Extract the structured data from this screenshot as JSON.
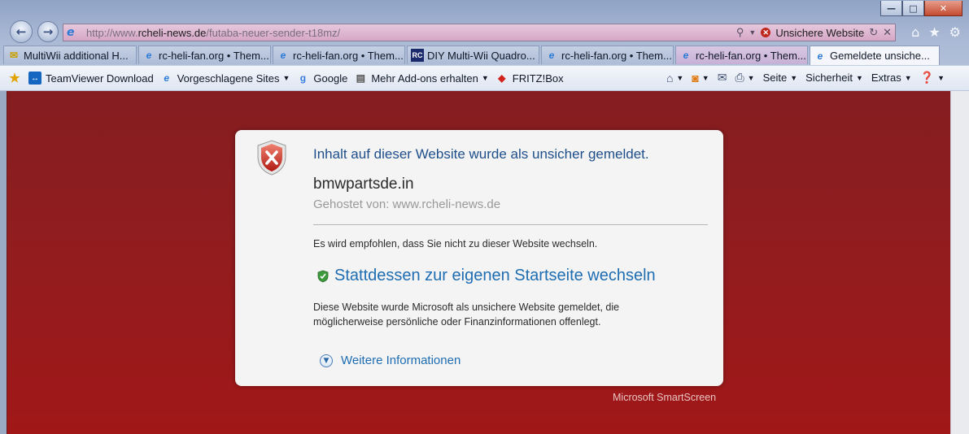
{
  "window": {
    "minimize": "—",
    "maximize": "□",
    "close": "✕"
  },
  "address": {
    "url_prefix": "http://www.",
    "url_domain": "rcheli-news.de",
    "url_path": "/futaba-neuer-sender-t18mz/",
    "security_status": "Unsichere Website"
  },
  "tabs": [
    {
      "label": "MultiWii additional H...",
      "icon": "forum-icon"
    },
    {
      "label": "rc-heli-fan.org • Them...",
      "icon": "ie-icon"
    },
    {
      "label": "rc-heli-fan.org • Them...",
      "icon": "ie-icon"
    },
    {
      "label": "DIY Multi-Wii Quadro...",
      "icon": "rc-icon"
    },
    {
      "label": "rc-heli-fan.org • Them...",
      "icon": "ie-icon"
    },
    {
      "label": "rc-heli-fan.org • Them...",
      "icon": "ie-icon"
    },
    {
      "label": "Gemeldete unsiche...",
      "icon": "ie-icon",
      "active": true
    }
  ],
  "favorites": [
    {
      "label": "TeamViewer Download",
      "icon": "teamviewer-icon"
    },
    {
      "label": "Vorgeschlagene Sites",
      "icon": "ie-icon",
      "dropdown": true
    },
    {
      "label": "Google",
      "icon": "google-icon"
    },
    {
      "label": "Mehr Add-ons erhalten",
      "icon": "page-icon",
      "dropdown": true
    },
    {
      "label": "FRITZ!Box",
      "icon": "fritz-icon"
    }
  ],
  "command_bar": {
    "page": "Seite",
    "security": "Sicherheit",
    "extras": "Extras"
  },
  "warning": {
    "title": "Inhalt auf dieser Website wurde als unsicher gemeldet.",
    "domain": "bmwpartsde.in",
    "hosted_by": "Gehostet von:  www.rcheli-news.de",
    "advice": "Es wird empfohlen, dass Sie nicht zu dieser Website wechseln.",
    "home_link": "Stattdessen zur eigenen Startseite wechseln",
    "description": "Diese Website wurde Microsoft als unsichere Website gemeldet, die möglicherweise persönliche oder Finanzinformationen offenlegt.",
    "more_info": "Weitere Informationen",
    "footer": "Microsoft SmartScreen"
  },
  "colors": {
    "danger_bg": "#901d1f",
    "link": "#1e6db2",
    "title": "#1e4f8a"
  }
}
